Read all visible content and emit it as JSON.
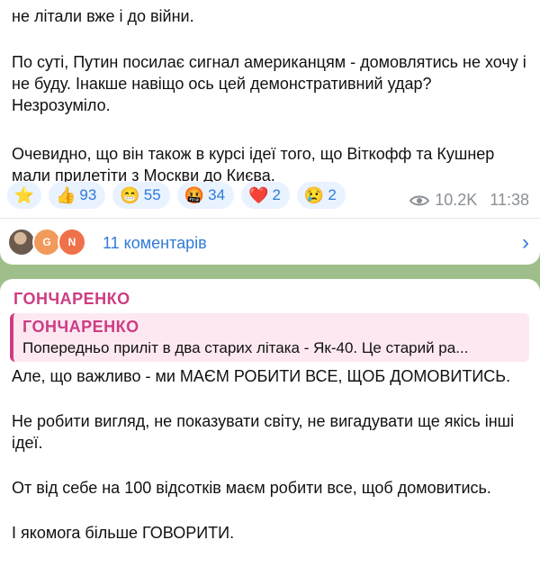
{
  "post1": {
    "paragraphs": [
      "не літали вже і до війни.",
      "По суті, Путин посилає сигнал американцям - домовлятись не хочу і не буду. Інакше навіщо ось цей демонстративний удар? Незрозуміло.",
      "Очевидно, що він також в курсі ідеї того, що Віткофф та Кушнер мали прилетіти з Москви до Києва."
    ],
    "reactions": [
      {
        "emoji": "⭐",
        "count": ""
      },
      {
        "emoji": "👍",
        "count": "93"
      },
      {
        "emoji": "😁",
        "count": "55"
      },
      {
        "emoji": "🤬",
        "count": "34"
      },
      {
        "emoji": "❤️",
        "count": "2"
      },
      {
        "emoji": "😢",
        "count": "2"
      }
    ],
    "views": "10.2K",
    "time": "11:38",
    "comments_label": "11 коментарів",
    "avatars": [
      {
        "initial": "",
        "color": "#6b5a4e"
      },
      {
        "initial": "G",
        "color": "#f19a5b"
      },
      {
        "initial": "N",
        "color": "#f0724a"
      }
    ]
  },
  "post2": {
    "author": "ГОНЧАРЕНКО",
    "reply": {
      "author": "ГОНЧАРЕНКО",
      "text": "Попередньо приліт в два старих літака - Як-40.   Це старий ра..."
    },
    "paragraphs": [
      "Але, що важливо - ми МАЄМ РОБИТИ ВСЕ, ЩОБ ДОМОВИТИСЬ.",
      "Не робити вигляд, не показувати світу, не вигадувати ще якісь інші ідеї.",
      "От від себе на 100 відсотків маєм робити все, щоб домовитись.",
      "І якомога більше ГОВОРИТИ."
    ]
  }
}
